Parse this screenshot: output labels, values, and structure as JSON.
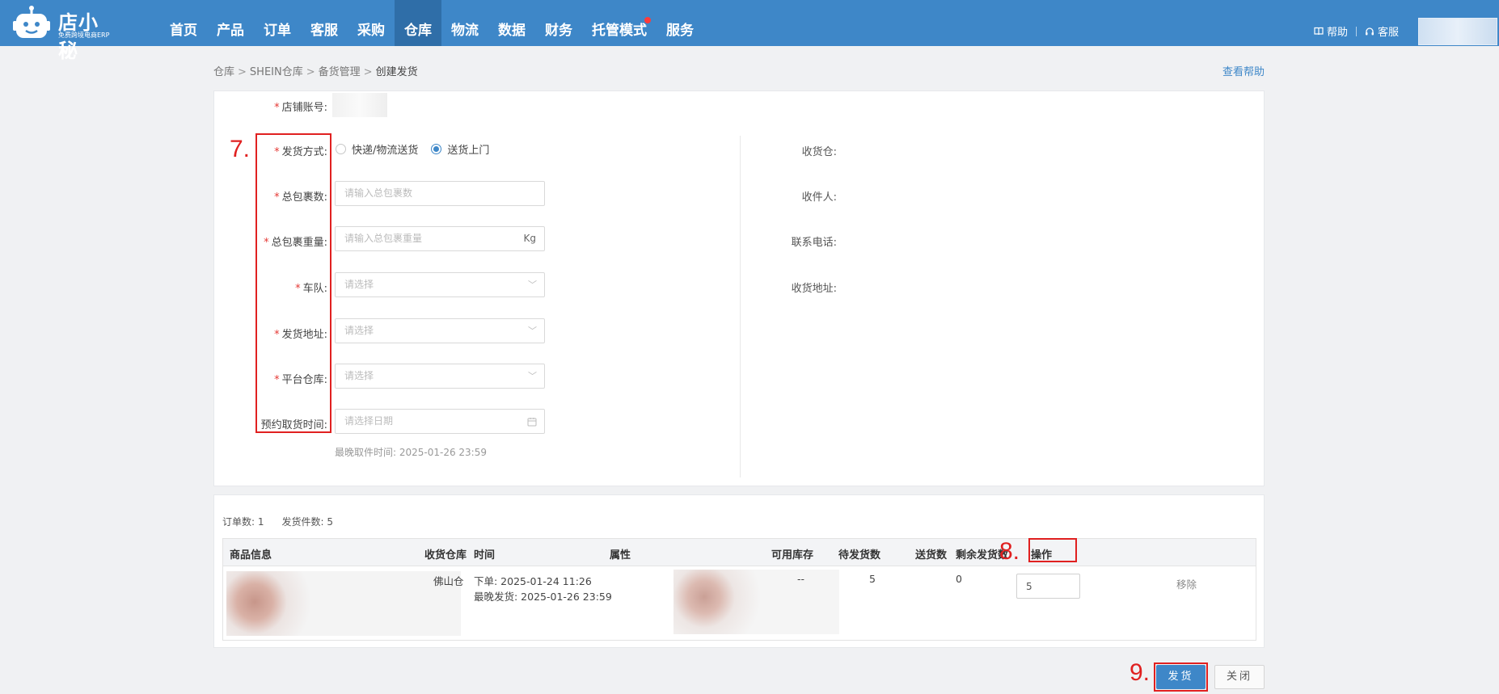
{
  "app": {
    "logo_name": "店小秘",
    "logo_subtitle": "免费跨境电商ERP",
    "brand_color": "#3e87c8"
  },
  "nav": {
    "items": [
      "首页",
      "产品",
      "订单",
      "客服",
      "采购",
      "仓库",
      "物流",
      "数据",
      "财务",
      "托管模式",
      "服务"
    ],
    "active": "仓库",
    "badge_item": "托管模式"
  },
  "top_right": {
    "help": "帮助",
    "service": "客服"
  },
  "breadcrumb": {
    "items": [
      "仓库",
      "SHEIN仓库",
      "备货管理"
    ],
    "current": "创建发货",
    "separator": ">"
  },
  "help_link": "查看帮助",
  "form": {
    "shop_account_label": "店铺账号:",
    "delivery_method_label": "发货方式:",
    "delivery_options": [
      "快递/物流送货",
      "送货上门"
    ],
    "delivery_selected": "送货上门",
    "total_packages_label": "总包裹数:",
    "total_packages_placeholder": "请输入总包裹数",
    "total_weight_label": "总包裹重量:",
    "total_weight_placeholder": "请输入总包裹重量",
    "weight_unit": "Kg",
    "fleet_label": "车队:",
    "fleet_placeholder": "请选择",
    "ship_address_label": "发货地址:",
    "ship_address_placeholder": "请选择",
    "platform_warehouse_label": "平台仓库:",
    "platform_warehouse_placeholder": "请选择",
    "pickup_time_label": "预约取货时间:",
    "pickup_time_placeholder": "请选择日期",
    "latest_pickup_hint": "最晚取件时间: 2025-01-26 23:59"
  },
  "receiver": {
    "warehouse_label": "收货仓:",
    "receiver_label": "收件人:",
    "phone_label": "联系电话:",
    "address_label": "收货地址:"
  },
  "summary": {
    "orders": "订单数: 1",
    "items": "发货件数: 5"
  },
  "table": {
    "headers": [
      "商品信息",
      "收货仓库",
      "时间",
      "属性",
      "可用库存",
      "待发货数",
      "送货数",
      "剩余发货数",
      "操作"
    ],
    "rows": [
      {
        "warehouse": "佛山仓",
        "order_time": "下单: 2025-01-24 11:26",
        "latest_ship": "最晚发货: 2025-01-26 23:59",
        "available_stock": "--",
        "pending": "5",
        "send_qty": "5",
        "remaining": "0",
        "action": "移除"
      }
    ]
  },
  "buttons": {
    "ship": "发货",
    "close": "关闭"
  },
  "annotations": {
    "step7": "7.",
    "step8": "8.",
    "step9": "9.",
    "color": "#e02020"
  }
}
